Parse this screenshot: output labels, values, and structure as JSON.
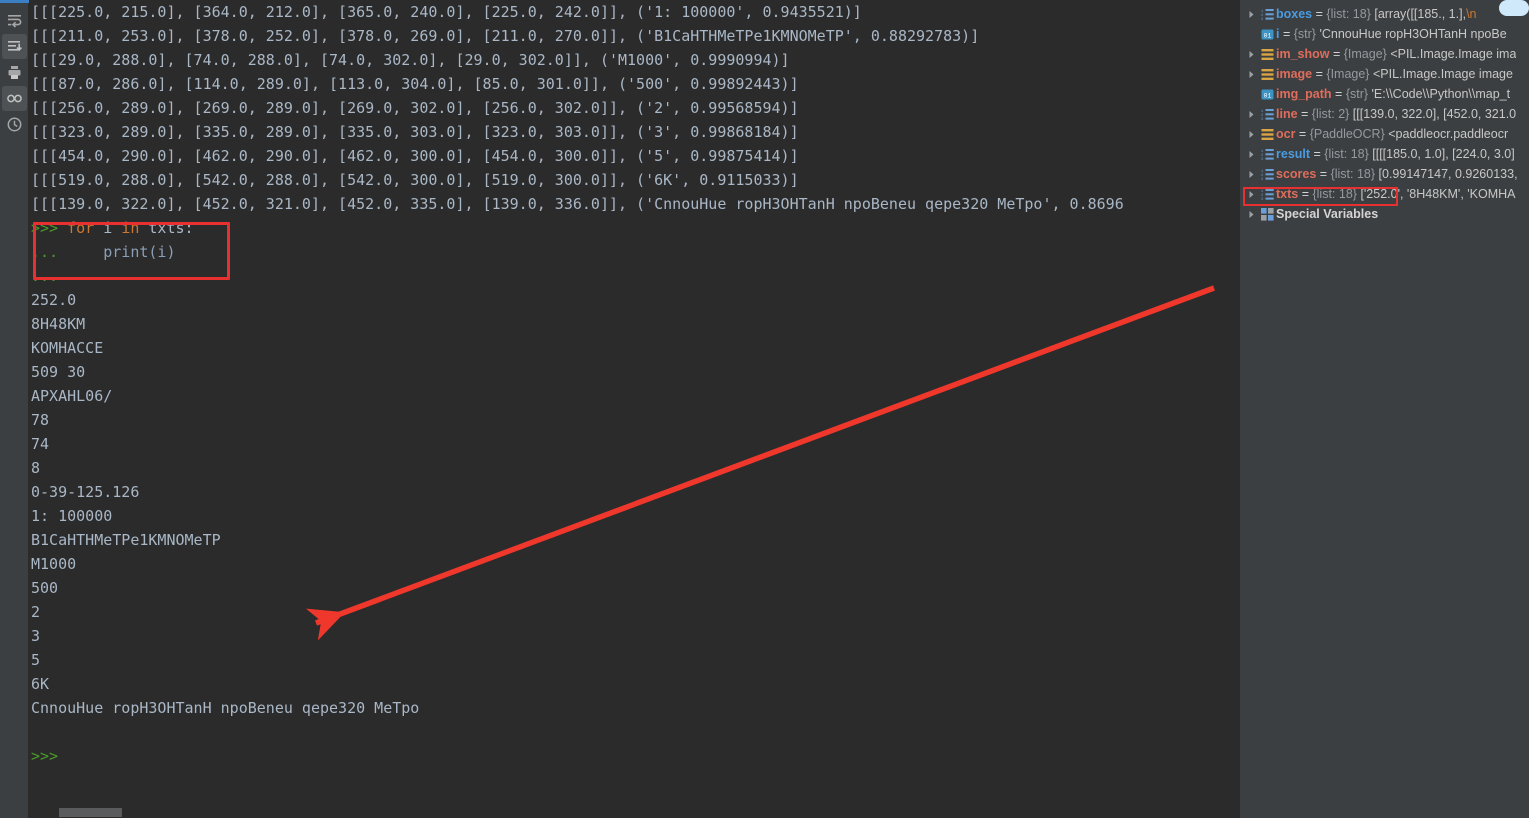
{
  "toolbar": {
    "items": [
      {
        "name": "soft-wrap-icon",
        "label": "Use Soft Wraps",
        "active": false
      },
      {
        "name": "scroll-to-end-icon",
        "label": "Scroll to End",
        "active": true
      },
      {
        "name": "print-icon",
        "label": "Print",
        "active": false
      },
      {
        "name": "glasses-icon",
        "label": "Mark Read",
        "active": true
      },
      {
        "name": "history-clock-icon",
        "label": "History",
        "active": false
      }
    ]
  },
  "console": {
    "lines": [
      {
        "type": "out",
        "text": "[[[225.0, 215.0], [364.0, 212.0], [365.0, 240.0], [225.0, 242.0]], ('1: 100000', 0.9435521)]"
      },
      {
        "type": "out",
        "text": "[[[211.0, 253.0], [378.0, 252.0], [378.0, 269.0], [211.0, 270.0]], ('B1CaHTHMeTPe1KMNOMeTP', 0.88292783)]"
      },
      {
        "type": "out",
        "text": "[[[29.0, 288.0], [74.0, 288.0], [74.0, 302.0], [29.0, 302.0]], ('M1000', 0.9990994)]"
      },
      {
        "type": "out",
        "text": "[[[87.0, 286.0], [114.0, 289.0], [113.0, 304.0], [85.0, 301.0]], ('500', 0.99892443)]"
      },
      {
        "type": "out",
        "text": "[[[256.0, 289.0], [269.0, 289.0], [269.0, 302.0], [256.0, 302.0]], ('2', 0.99568594)]"
      },
      {
        "type": "out",
        "text": "[[[323.0, 289.0], [335.0, 289.0], [335.0, 303.0], [323.0, 303.0]], ('3', 0.99868184)]"
      },
      {
        "type": "out",
        "text": "[[[454.0, 290.0], [462.0, 290.0], [462.0, 300.0], [454.0, 300.0]], ('5', 0.99875414)]"
      },
      {
        "type": "out",
        "text": "[[[519.0, 288.0], [542.0, 288.0], [542.0, 300.0], [519.0, 300.0]], ('6K', 0.9115033)]"
      },
      {
        "type": "out",
        "text": "[[[139.0, 322.0], [452.0, 321.0], [452.0, 335.0], [139.0, 336.0]], ('CnnouHue ropH3OHTanH npoBeneu qepe320 MeTpo', 0.8696"
      },
      {
        "type": "code-for",
        "prompt": ">>> ",
        "kw1": "for",
        "mid": " i ",
        "kw2": "in",
        "tail": " txts:"
      },
      {
        "type": "code-print",
        "prompt": "... ",
        "indent": "    ",
        "fn": "print",
        "args": "(i)"
      },
      {
        "type": "prompt-only",
        "prompt": "..."
      },
      {
        "type": "out",
        "text": "252.0"
      },
      {
        "type": "out",
        "text": "8H48KM"
      },
      {
        "type": "out",
        "text": "KOMHACCE"
      },
      {
        "type": "out",
        "text": "509 30"
      },
      {
        "type": "out",
        "text": "APXAHL06/"
      },
      {
        "type": "out",
        "text": "78"
      },
      {
        "type": "out",
        "text": "74"
      },
      {
        "type": "out",
        "text": "8"
      },
      {
        "type": "out",
        "text": "0-39-125.126"
      },
      {
        "type": "out",
        "text": "1: 100000"
      },
      {
        "type": "out",
        "text": "B1CaHTHMeTPe1KMNOMeTP"
      },
      {
        "type": "out",
        "text": "M1000"
      },
      {
        "type": "out",
        "text": "500"
      },
      {
        "type": "out",
        "text": "2"
      },
      {
        "type": "out",
        "text": "3"
      },
      {
        "type": "out",
        "text": "5"
      },
      {
        "type": "out",
        "text": "6K"
      },
      {
        "type": "out",
        "text": "CnnouHue ropH3OHTanH npoBeneu qepe320 MeTpo"
      },
      {
        "type": "blank",
        "text": ""
      },
      {
        "type": "prompt-only",
        "prompt": ">>>"
      }
    ]
  },
  "variables": {
    "rows": [
      {
        "name": "boxes",
        "color": "blue",
        "icon": "list-icon",
        "expandable": true,
        "type": "{list: 18}",
        "value": "[array([[185.,   1.],",
        "escape": "\\n"
      },
      {
        "name": "i",
        "color": "blue",
        "icon": "str-icon",
        "expandable": false,
        "type": "{str}",
        "value": "'CnnouHue ropH3OHTanH npoBe",
        "escape": ""
      },
      {
        "name": "im_show",
        "color": "red",
        "icon": "object-icon",
        "expandable": true,
        "type": "{Image}",
        "value": "<PIL.Image.Image ima",
        "escape": ""
      },
      {
        "name": "image",
        "color": "red",
        "icon": "object-icon",
        "expandable": true,
        "type": "{Image}",
        "value": "<PIL.Image.Image image",
        "escape": ""
      },
      {
        "name": "img_path",
        "color": "red",
        "icon": "str-icon",
        "expandable": false,
        "type": "{str}",
        "value": "'E:\\\\Code\\\\Python\\\\map_t",
        "escape": ""
      },
      {
        "name": "line",
        "color": "red",
        "icon": "list-icon",
        "expandable": true,
        "type": "{list: 2}",
        "value": "[[[139.0, 322.0], [452.0, 321.0",
        "escape": ""
      },
      {
        "name": "ocr",
        "color": "red",
        "icon": "object-icon",
        "expandable": true,
        "type": "{PaddleOCR}",
        "value": "<paddleocr.paddleocr",
        "escape": ""
      },
      {
        "name": "result",
        "color": "blue",
        "icon": "list-icon",
        "expandable": true,
        "type": "{list: 18}",
        "value": "[[[[185.0, 1.0], [224.0, 3.0]",
        "escape": ""
      },
      {
        "name": "scores",
        "color": "red",
        "icon": "list-icon",
        "expandable": true,
        "type": "{list: 18}",
        "value": "[0.99147147, 0.9260133,",
        "escape": ""
      },
      {
        "name": "txts",
        "color": "red",
        "icon": "list-icon",
        "expandable": true,
        "type": "{list: 18}",
        "value": "['252.0', '8H48KM', 'KOMHA",
        "escape": ""
      }
    ],
    "special_variables": "Special Variables"
  },
  "colors": {
    "console_bg": "#2b2b2b",
    "panel_bg": "#3c3f41",
    "text": "#a9b7c6",
    "keyword": "#cc7832",
    "prompt_green": "#4a9c28",
    "annotation_red": "#e83030",
    "var_blue": "#4a9be0",
    "var_red": "#e06c5b",
    "accent_blue": "#3b7fc4"
  }
}
